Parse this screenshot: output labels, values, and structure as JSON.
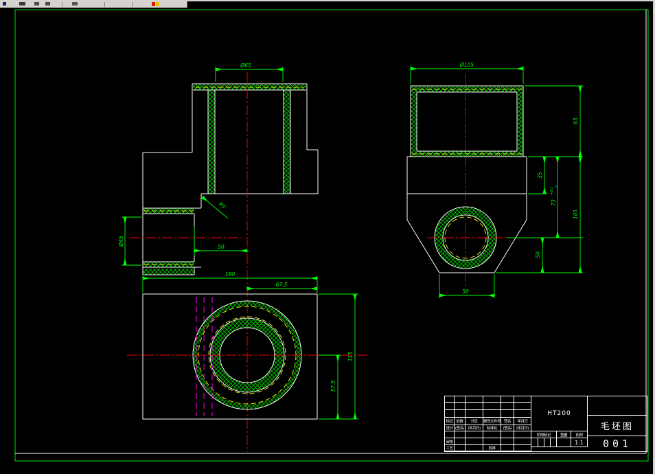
{
  "colors": {
    "cad_green": "#00ff00",
    "outline_white": "#ffffff",
    "centerline_red": "#ff0000",
    "blank_outline_yellow": "#ffff00",
    "hidden_line_magenta": "#ff00ff",
    "hatch_green": "#00b400",
    "canvas_black": "#000000",
    "toolbar_grey": "#d6d3ce"
  },
  "views": {
    "front": {
      "dim_bore_diameter": "Ø65",
      "dim_boss_diameter": "Ø45",
      "dim_fillet": "R5",
      "dim_offset": "50"
    },
    "side": {
      "dim_outer_diameter": "Ø105",
      "dim_cylinder_height": "65",
      "dim_step": "35",
      "dim_hole_center": "73",
      "dim_hole_center_tol_upper": "+0.1",
      "dim_hole_center_tol_lower": "0",
      "dim_hole_to_bottom": "50",
      "dim_base_height": "105",
      "dim_foot_width": "50"
    },
    "bottom": {
      "dim_length": "160",
      "dim_center_to_right": "67.5",
      "dim_width": "115",
      "dim_center_to_edge": "57.5"
    }
  },
  "title_block": {
    "material": "HT200",
    "drawing_title": "毛坯图",
    "drawing_number": "001",
    "scale_value": "1:1",
    "row_mark": {
      "mark": "标记",
      "count": "处数",
      "zone": "分区",
      "change_no": "更改文件号",
      "sign": "签名",
      "date": "年月日"
    },
    "row_design": {
      "design": "设计",
      "sign": "(签名)",
      "date": "(年月日)",
      "standard": "标准化",
      "sign2": "(签名)",
      "date2": "(年月日)"
    },
    "labels": {
      "stage": "阶段标记",
      "weight": "重量",
      "scale": "比例",
      "check": "审核",
      "process": "工艺",
      "approve": "批准"
    }
  }
}
